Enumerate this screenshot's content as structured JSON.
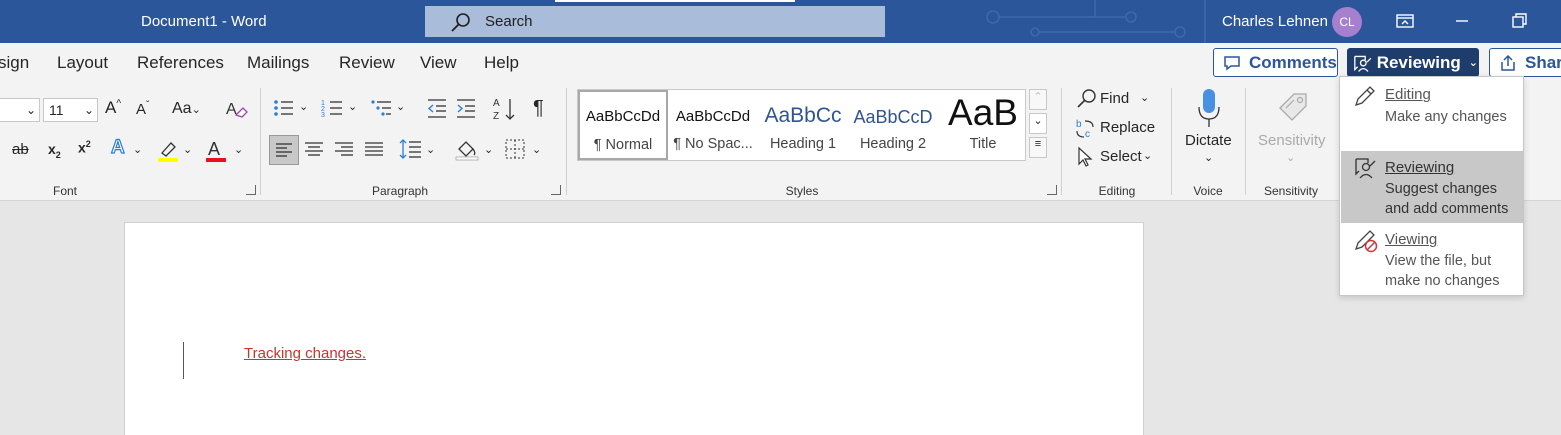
{
  "window": {
    "doc_title": "Document1  -  Word",
    "search_placeholder": "Search",
    "user_name": "Charles Lehnen",
    "avatar_initials": "CL"
  },
  "tabs": [
    "sign",
    "Layout",
    "References",
    "Mailings",
    "Review",
    "View",
    "Help"
  ],
  "header_buttons": {
    "comments": "Comments",
    "reviewing": "Reviewing",
    "share": "Share"
  },
  "font": {
    "size": "11",
    "change_case": "Aa",
    "group_label": "Font"
  },
  "paragraph": {
    "group_label": "Paragraph"
  },
  "styles": {
    "group_label": "Styles",
    "items": [
      {
        "preview": "AaBbCcDd",
        "name": "¶ Normal"
      },
      {
        "preview": "AaBbCcDd",
        "name": "¶ No Spac..."
      },
      {
        "preview": "AaBbCc",
        "name": "Heading 1"
      },
      {
        "preview": "AaBbCcD",
        "name": "Heading 2"
      },
      {
        "preview": "AaB",
        "name": "Title"
      }
    ]
  },
  "editing": {
    "find": "Find",
    "replace": "Replace",
    "select": "Select",
    "group_label": "Editing"
  },
  "voice": {
    "dictate": "Dictate",
    "group_label": "Voice"
  },
  "sensitivity": {
    "button": "Sensitivity",
    "group_label": "Sensitivity"
  },
  "document": {
    "text": "Tracking changes."
  },
  "mode_menu": {
    "items": [
      {
        "title": "Editing",
        "desc": "Make any changes"
      },
      {
        "title": "Reviewing",
        "desc": "Suggest changes and add comments"
      },
      {
        "title": "Viewing",
        "desc": "View the file, but make no changes"
      }
    ]
  },
  "colors": {
    "title_bar": "#2b579a",
    "highlight": "#ffff00",
    "font_color": "#e81123",
    "tracked_text": "#c0392b"
  }
}
